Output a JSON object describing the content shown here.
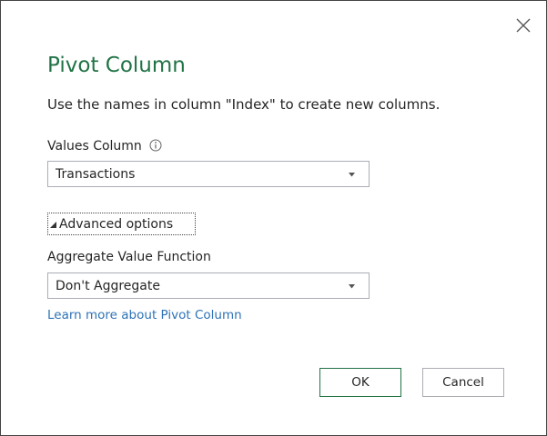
{
  "dialog": {
    "title": "Pivot Column",
    "description": "Use the names in column \"Index\" to create new columns.",
    "close_icon": "close-icon"
  },
  "values_column": {
    "label": "Values Column",
    "info_icon": "info-icon",
    "selected": "Transactions"
  },
  "advanced": {
    "toggle_label": "Advanced options",
    "expanded": true,
    "aggregate_label": "Aggregate Value Function",
    "aggregate_selected": "Don't Aggregate"
  },
  "link": {
    "text": "Learn more about Pivot Column"
  },
  "buttons": {
    "ok": "OK",
    "cancel": "Cancel"
  },
  "colors": {
    "title": "#217346",
    "link": "#2e73b6",
    "ok_border": "#217346"
  }
}
